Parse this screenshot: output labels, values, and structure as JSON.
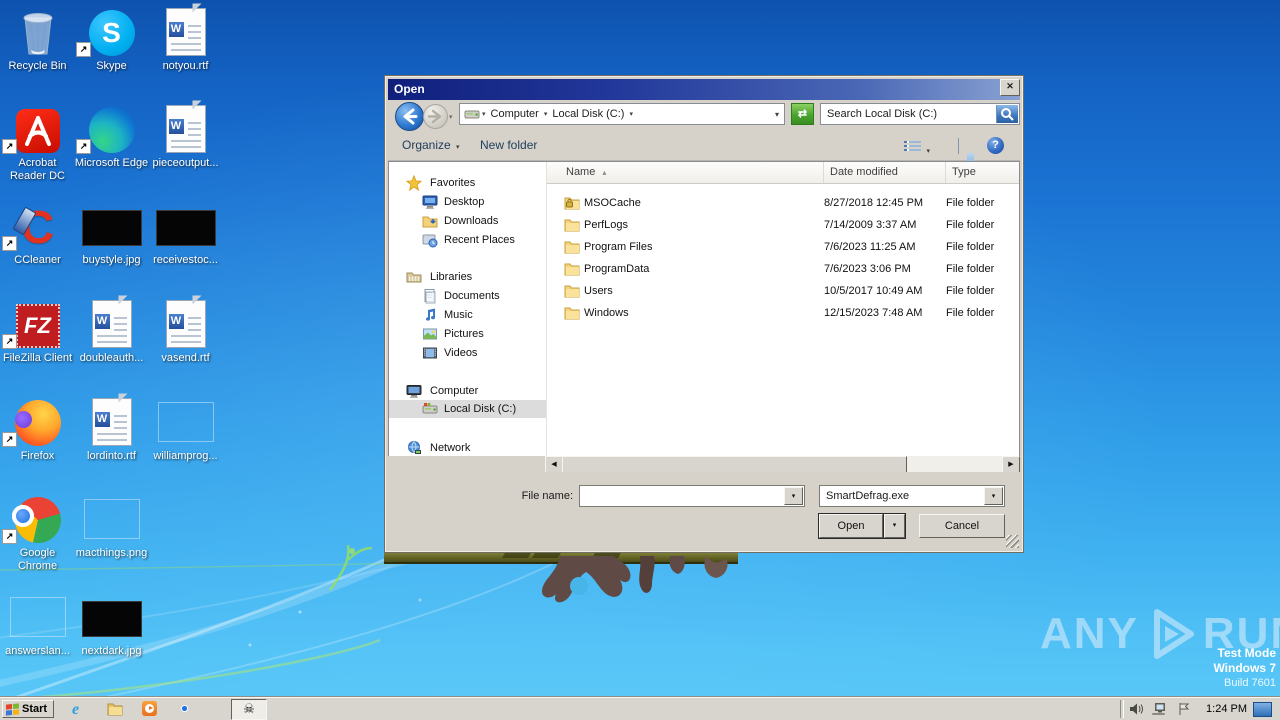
{
  "icons_map": {
    "close": "✕",
    "dropdown": "▾",
    "sort_asc": "▴",
    "scroll_left": "◀",
    "scroll_right": "▶",
    "help": "?",
    "skull": "☠",
    "shortcut_arrow": "↗",
    "refresh": "⇄",
    "skype_s": "S",
    "word_w": "W",
    "fz": "FZ",
    "ccleaner_c": "C",
    "ie_e": "e"
  },
  "colors": {
    "titlebar_left": "#101f7c",
    "titlebar_right": "#8aa2d2",
    "dialog_face": "#d6d2c9",
    "selection_gray": "#dcdcdc",
    "desktop_top": "#0e52ae",
    "desktop_bottom": "#5bc9f8",
    "go_button_green": "#49a52e",
    "search_button_blue": "#3e77bc"
  },
  "dialog": {
    "title": "Open",
    "address": {
      "crumbs": [
        "Computer",
        "Local Disk (C:)"
      ]
    },
    "search_placeholder": "Search Local Disk (C:)",
    "toolbar": {
      "organize": "Organize",
      "new_folder": "New folder"
    },
    "sidebar": {
      "groups": [
        {
          "label": "Favorites",
          "items": [
            {
              "label": "Desktop"
            },
            {
              "label": "Downloads"
            },
            {
              "label": "Recent Places"
            }
          ]
        },
        {
          "label": "Libraries",
          "items": [
            {
              "label": "Documents"
            },
            {
              "label": "Music"
            },
            {
              "label": "Pictures"
            },
            {
              "label": "Videos"
            }
          ]
        },
        {
          "label": "Computer",
          "items": [
            {
              "label": "Local Disk (C:)",
              "selected": true
            }
          ]
        },
        {
          "label": "Network",
          "items": []
        }
      ]
    },
    "columns": [
      {
        "label": "Name"
      },
      {
        "label": "Date modified"
      },
      {
        "label": "Type"
      }
    ],
    "files": [
      {
        "name": "MSOCache",
        "date": "8/27/2018 12:45 PM",
        "type": "File folder",
        "icon": "folder-locked"
      },
      {
        "name": "PerfLogs",
        "date": "7/14/2009 3:37 AM",
        "type": "File folder",
        "icon": "folder"
      },
      {
        "name": "Program Files",
        "date": "7/6/2023 11:25 AM",
        "type": "File folder",
        "icon": "folder"
      },
      {
        "name": "ProgramData",
        "date": "7/6/2023 3:06 PM",
        "type": "File folder",
        "icon": "folder"
      },
      {
        "name": "Users",
        "date": "10/5/2017 10:49 AM",
        "type": "File folder",
        "icon": "folder"
      },
      {
        "name": "Windows",
        "date": "12/15/2023 7:48 AM",
        "type": "File folder",
        "icon": "folder"
      }
    ],
    "footer": {
      "file_name_label": "File name:",
      "file_name_value": "",
      "filter_value": "SmartDefrag.exe",
      "open_label": "Open",
      "cancel_label": "Cancel"
    }
  },
  "desktop": {
    "icons": [
      {
        "label": "Recycle Bin",
        "icon": "recycle-bin"
      },
      {
        "label": "Skype",
        "icon": "skype-shortcut"
      },
      {
        "label": "notyou.rtf",
        "icon": "word-document"
      },
      {
        "label": "Acrobat Reader DC",
        "icon": "acrobat-shortcut"
      },
      {
        "label": "Microsoft Edge",
        "icon": "edge-shortcut"
      },
      {
        "label": "pieceoutput...",
        "icon": "word-document"
      },
      {
        "label": "CCleaner",
        "icon": "ccleaner-shortcut"
      },
      {
        "label": "buystyle.jpg",
        "icon": "jpg-thumbnail-dark"
      },
      {
        "label": "receivestoc...",
        "icon": "jpg-thumbnail-dark"
      },
      {
        "label": "FileZilla Client",
        "icon": "filezilla-shortcut"
      },
      {
        "label": "doubleauth...",
        "icon": "word-document"
      },
      {
        "label": "vasend.rtf",
        "icon": "word-document"
      },
      {
        "label": "Firefox",
        "icon": "firefox-shortcut"
      },
      {
        "label": "lordinto.rtf",
        "icon": "word-document"
      },
      {
        "label": "williamprog...",
        "icon": "broken-thumbnail"
      },
      {
        "label": "Google Chrome",
        "icon": "chrome-shortcut"
      },
      {
        "label": "macthings.png",
        "icon": "broken-thumbnail"
      },
      {
        "label": "answerslan...",
        "icon": "broken-thumbnail"
      },
      {
        "label": "nextdark.jpg",
        "icon": "jpg-thumbnail-dark"
      }
    ]
  },
  "taskbar": {
    "start_label": "Start",
    "clock": "1:24 PM"
  },
  "watermark": {
    "brand_left": "ANY",
    "brand_right": "RUN",
    "mode": "Test Mode",
    "os": "Windows 7",
    "build": "Build 7601"
  }
}
